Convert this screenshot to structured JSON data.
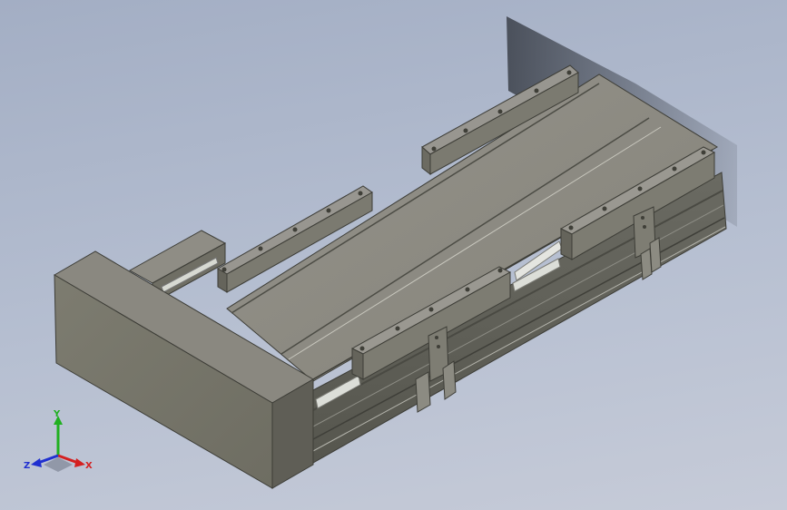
{
  "viewport": {
    "background_top": "#a3aec4",
    "background_bottom": "#c6cbd8"
  },
  "model": {
    "body_color": "#7f7e71",
    "top_color": "#8d8b7f",
    "dark_color": "#55554b",
    "rod_color": "#d9dbd5"
  },
  "triad": {
    "x_label": "X",
    "y_label": "Y",
    "z_label": "Z",
    "x_color": "#d42020",
    "y_color": "#20b020",
    "z_color": "#2030d0"
  }
}
